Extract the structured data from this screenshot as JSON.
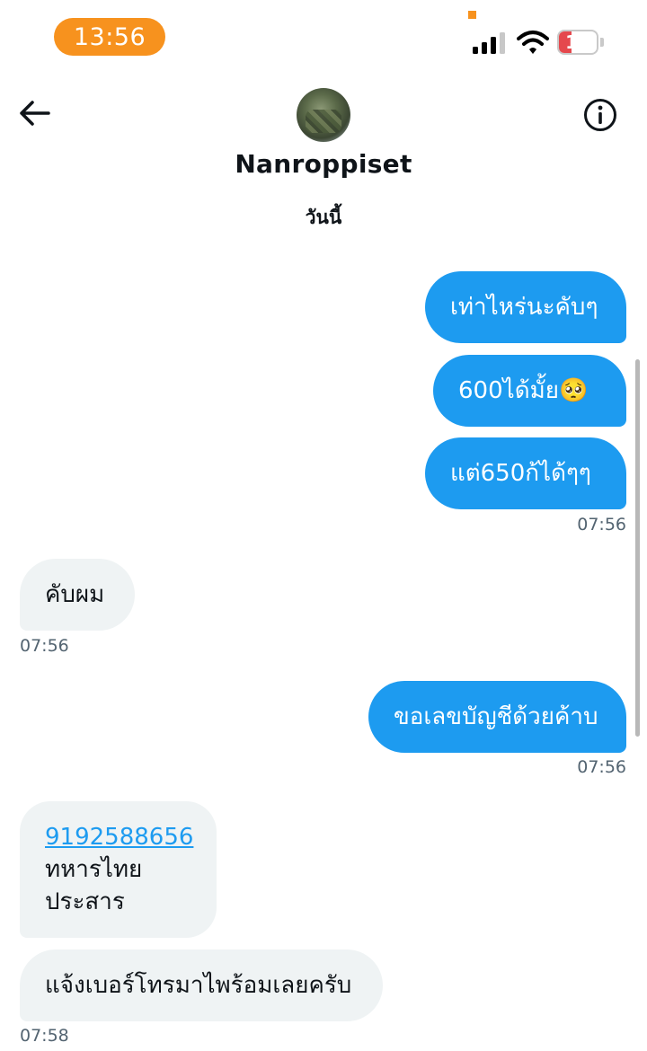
{
  "status_bar": {
    "time": "13:56",
    "battery": "18",
    "battery_level_percent": 18,
    "accent_color": "#f7921e"
  },
  "header": {
    "contact_name": "Nanroppiset",
    "day_label": "วันนี้",
    "back_icon": "arrow-left-icon",
    "info_icon": "info-circle-icon"
  },
  "messages": [
    {
      "direction": "outgoing",
      "text": "เท่าไหร่นะคับๆ"
    },
    {
      "direction": "outgoing",
      "text": "600ได้มั้ย🥺"
    },
    {
      "direction": "outgoing",
      "text": "แต่650ก้ได้ๆๆ",
      "time": "07:56"
    },
    {
      "direction": "incoming",
      "text": "คับผม",
      "time": "07:56"
    },
    {
      "direction": "outgoing",
      "text": "ขอเลขบัญชีด้วยค้าบ",
      "time": "07:56"
    },
    {
      "direction": "incoming",
      "lines": [
        "9192588656",
        "ทหารไทย",
        "ประสาร"
      ]
    },
    {
      "direction": "incoming",
      "text": "แจ้งเบอร์โทรมาไพร้อมเลยครับ",
      "time": "07:58"
    }
  ],
  "colors": {
    "outgoing_bubble": "#1d9bf0",
    "incoming_bubble": "#eff3f4",
    "link": "#1d9bf0"
  }
}
